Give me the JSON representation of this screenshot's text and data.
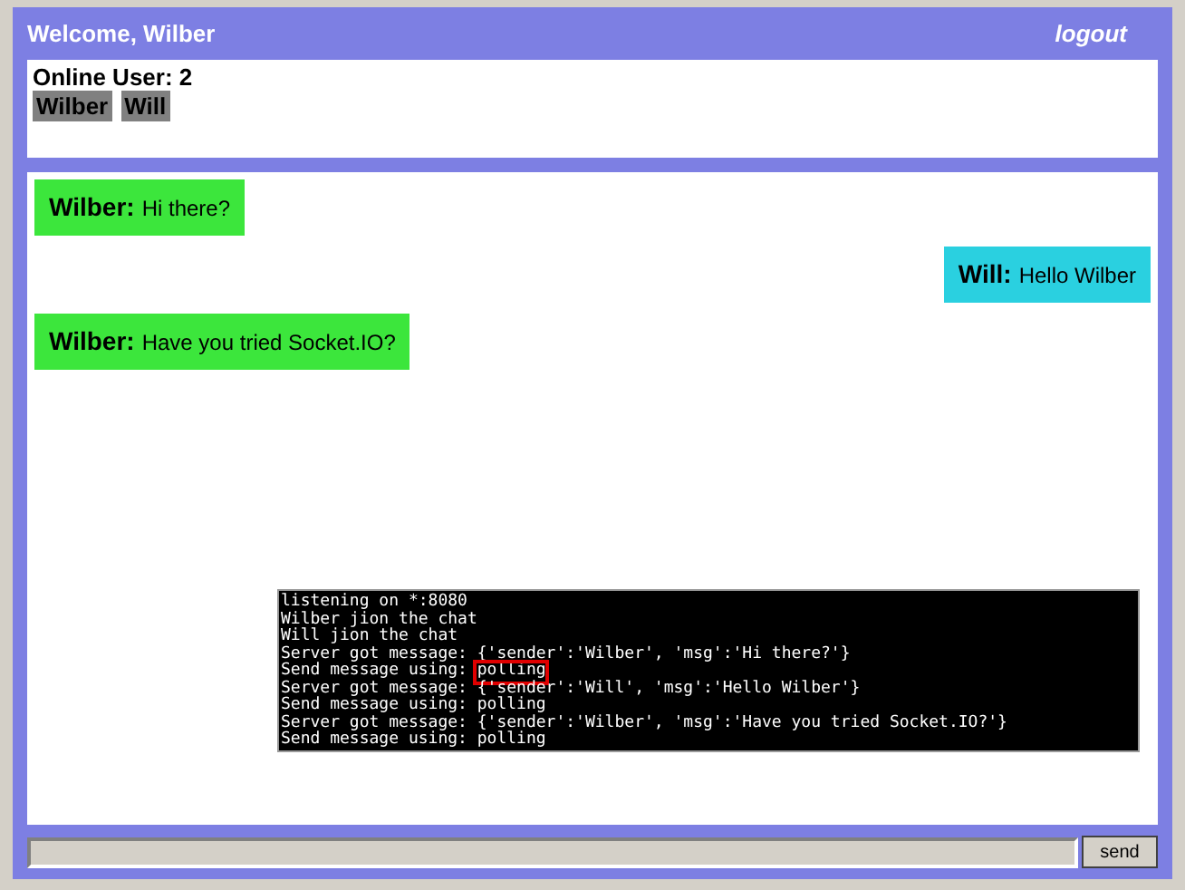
{
  "header": {
    "title": "Welcome, Wilber",
    "logout": "logout"
  },
  "online": {
    "label": "Online User: 2",
    "users": [
      "Wilber",
      "Will"
    ]
  },
  "messages": [
    {
      "sender": "Wilber:",
      "text": "Hi there?",
      "kind": "received",
      "color": "#3ce63c"
    },
    {
      "sender": "Will:",
      "text": "Hello Wilber",
      "kind": "sent",
      "color": "#2ad0e0"
    },
    {
      "sender": "Wilber:",
      "text": "Have you tried Socket.IO?",
      "kind": "received",
      "color": "#3ce63c"
    }
  ],
  "terminal": {
    "lines": [
      {
        "text": "listening on *:8080"
      },
      {
        "text": "Wilber jion the chat"
      },
      {
        "text": "Will jion the chat"
      },
      {
        "text": "Server got message: {'sender':'Wilber', 'msg':'Hi there?'}"
      },
      {
        "text": "Send message using: ",
        "highlight": "polling"
      },
      {
        "text": "Server got message: {'sender':'Will', 'msg':'Hello Wilber'}"
      },
      {
        "text": "Send message using: polling"
      },
      {
        "text": "Server got message: {'sender':'Wilber', 'msg':'Have you tried Socket.IO?'}"
      },
      {
        "text": "Send message using: polling"
      }
    ]
  },
  "composer": {
    "button": "send"
  }
}
